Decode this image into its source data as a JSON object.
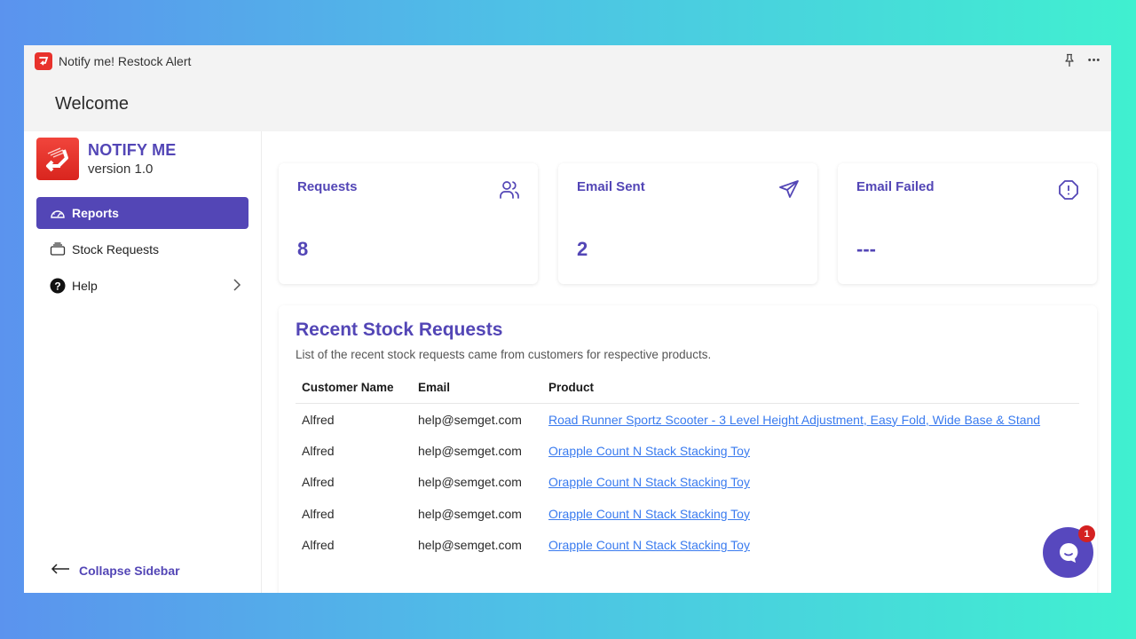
{
  "window": {
    "title": "Notify me! Restock Alert",
    "actions": [
      {
        "name": "pin",
        "icon": "pin-icon"
      },
      {
        "name": "more",
        "icon": "more-icon",
        "glyph": "•••"
      }
    ]
  },
  "header": {
    "title": "Welcome"
  },
  "brand": {
    "name": "NOTIFY ME",
    "version": "version 1.0"
  },
  "sidebar": {
    "items": [
      {
        "label": "Reports",
        "icon": "gauge-icon",
        "active": true
      },
      {
        "label": "Stock Requests",
        "icon": "inbox-icon",
        "active": false
      },
      {
        "label": "Help",
        "icon": "help-circle-icon",
        "active": false,
        "has_submenu": true
      }
    ],
    "collapse_label": "Collapse Sidebar"
  },
  "stats": [
    {
      "title": "Requests",
      "value": "8",
      "icon": "users-icon"
    },
    {
      "title": "Email Sent",
      "value": "2",
      "icon": "send-icon"
    },
    {
      "title": "Email Failed",
      "value": "---",
      "icon": "alert-octagon-icon"
    }
  ],
  "recent": {
    "title": "Recent Stock Requests",
    "subtitle": "List of the recent stock requests came from customers for respective products.",
    "columns": [
      "Customer Name",
      "Email",
      "Product"
    ],
    "rows": [
      {
        "customer": "Alfred",
        "email": "help@semget.com",
        "product": "Road Runner Sportz Scooter - 3 Level Height Adjustment, Easy Fold, Wide Base & Stand"
      },
      {
        "customer": "Alfred",
        "email": "help@semget.com",
        "product": "Orapple Count N Stack Stacking Toy"
      },
      {
        "customer": "Alfred",
        "email": "help@semget.com",
        "product": "Orapple Count N Stack Stacking Toy"
      },
      {
        "customer": "Alfred",
        "email": "help@semget.com",
        "product": "Orapple Count N Stack Stacking Toy"
      },
      {
        "customer": "Alfred",
        "email": "help@semget.com",
        "product": "Orapple Count N Stack Stacking Toy"
      }
    ]
  },
  "chat": {
    "badge": "1",
    "icon": "chat-icon"
  },
  "colors": {
    "accent": "#5346b6",
    "link": "#3a7bef",
    "logo": "#e8322c",
    "badge": "#d42121"
  }
}
